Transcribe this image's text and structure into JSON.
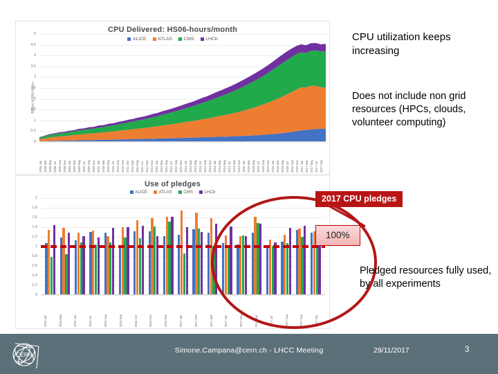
{
  "slide": {
    "page_number": "3"
  },
  "texts": {
    "headline": "CPU utilization keeps increasing",
    "subtext": "Does not include non grid resources (HPCs, clouds, volunteer computing)",
    "bottom": "Pledged resources fully used, by all experiments"
  },
  "callouts": {
    "pledges_label": "2017 CPU pledges",
    "percent_label": "100%"
  },
  "footer": {
    "author": "Simone.Campana@cern.ch - LHCC Meeting",
    "date": "29/11/2017",
    "page": "3",
    "logo": "cern-logo"
  },
  "colors": {
    "alice": "#4472C4",
    "atlas": "#ED7D31",
    "cms": "#22A94C",
    "lhcb": "#7030A0",
    "accent_red": "#b81515",
    "pledge_line": "#c00000",
    "footer_bg": "#5c7079"
  },
  "chart_data": [
    {
      "type": "area",
      "id": "cpu-delivered",
      "title": "CPU Delivered: HS06-hours/month",
      "ylabel": "Billion HS06-hours",
      "xlabel": "",
      "stacked": true,
      "grid": true,
      "legend_position": "top",
      "ylim": [
        0,
        5
      ],
      "yticks": [
        0,
        0.5,
        1,
        1.5,
        2,
        2.5,
        3,
        3.5,
        4,
        4.5,
        5
      ],
      "ytick_labels": [
        "0",
        "0.5",
        "1",
        "1.5",
        "2",
        "2.5",
        "3",
        "3.5",
        "4",
        "4.5",
        "5"
      ],
      "categories": [
        "2008 Jan",
        "2008 Mar",
        "2008 May",
        "2008 Jul",
        "2008 Sep",
        "2008 Nov",
        "2009 Jan",
        "2009 Mar",
        "2009 May",
        "2009 Jul",
        "2009 Sep",
        "2009 Nov",
        "2010 Jan",
        "2010 Mar",
        "2010 May",
        "2010 Jul",
        "2010 Sep",
        "2010 Nov",
        "2011 Jan",
        "2011 Mar",
        "2011 May",
        "2011 Jul",
        "2011 Sep",
        "2011 Nov",
        "2012 Jan",
        "2012 Mar",
        "2012 May",
        "2012 Jul",
        "2012 Sep",
        "2012 Nov",
        "2013 Jan",
        "2013 Mar",
        "2013 May",
        "2013 Jul",
        "2013 Sep",
        "2013 Nov",
        "2014 Jan",
        "2014 Mar",
        "2014 May",
        "2014 Jul",
        "2014 Sep",
        "2014 Nov",
        "2015 Jan",
        "2015 Mar",
        "2015 May",
        "2015 Jul",
        "2015 Sep",
        "2015 Nov",
        "2016 Jan",
        "2016 Mar",
        "2016 May",
        "2016 Jul",
        "2016 Sep",
        "2016 Nov",
        "2017 Jan",
        "2017 Mar",
        "2017 May",
        "2017 Jul",
        "2017 Sep"
      ],
      "series": [
        {
          "name": "ALICE",
          "color": "#4472C4",
          "values": [
            0.03,
            0.04,
            0.05,
            0.05,
            0.06,
            0.06,
            0.07,
            0.07,
            0.08,
            0.08,
            0.09,
            0.09,
            0.1,
            0.1,
            0.11,
            0.11,
            0.12,
            0.12,
            0.13,
            0.13,
            0.14,
            0.14,
            0.15,
            0.15,
            0.16,
            0.17,
            0.17,
            0.18,
            0.18,
            0.19,
            0.2,
            0.2,
            0.21,
            0.22,
            0.22,
            0.23,
            0.24,
            0.24,
            0.25,
            0.26,
            0.27,
            0.28,
            0.29,
            0.3,
            0.31,
            0.33,
            0.34,
            0.36,
            0.38,
            0.4,
            0.43,
            0.46,
            0.5,
            0.53,
            0.56,
            0.58,
            0.6,
            0.61,
            0.62
          ]
        },
        {
          "name": "ATLAS",
          "color": "#ED7D31",
          "values": [
            0.1,
            0.13,
            0.16,
            0.18,
            0.2,
            0.21,
            0.23,
            0.25,
            0.27,
            0.28,
            0.3,
            0.31,
            0.33,
            0.34,
            0.36,
            0.38,
            0.4,
            0.42,
            0.44,
            0.46,
            0.48,
            0.5,
            0.52,
            0.55,
            0.57,
            0.6,
            0.62,
            0.65,
            0.68,
            0.71,
            0.74,
            0.77,
            0.8,
            0.83,
            0.86,
            0.9,
            0.94,
            0.98,
            1.02,
            1.06,
            1.1,
            1.15,
            1.2,
            1.26,
            1.32,
            1.38,
            1.45,
            1.52,
            1.6,
            1.68,
            1.76,
            1.84,
            1.92,
            2.0,
            1.96,
            2.02,
            2.0,
            1.92,
            1.9
          ]
        },
        {
          "name": "CMS",
          "color": "#22A94C",
          "values": [
            0.07,
            0.09,
            0.11,
            0.13,
            0.14,
            0.15,
            0.16,
            0.17,
            0.19,
            0.2,
            0.21,
            0.22,
            0.24,
            0.25,
            0.27,
            0.28,
            0.3,
            0.32,
            0.34,
            0.36,
            0.38,
            0.4,
            0.42,
            0.45,
            0.47,
            0.5,
            0.53,
            0.56,
            0.59,
            0.62,
            0.65,
            0.68,
            0.72,
            0.76,
            0.8,
            0.84,
            0.88,
            0.92,
            0.96,
            1.0,
            1.05,
            1.1,
            1.15,
            1.2,
            1.25,
            1.3,
            1.36,
            1.42,
            1.48,
            1.54,
            1.58,
            1.62,
            1.64,
            1.62,
            1.6,
            1.62,
            1.64,
            1.66,
            1.68
          ]
        },
        {
          "name": "LHCb",
          "color": "#7030A0",
          "values": [
            0.02,
            0.03,
            0.04,
            0.04,
            0.05,
            0.05,
            0.06,
            0.06,
            0.07,
            0.07,
            0.08,
            0.08,
            0.09,
            0.09,
            0.1,
            0.1,
            0.11,
            0.11,
            0.12,
            0.12,
            0.13,
            0.13,
            0.14,
            0.15,
            0.15,
            0.16,
            0.17,
            0.17,
            0.18,
            0.19,
            0.2,
            0.21,
            0.22,
            0.23,
            0.24,
            0.25,
            0.26,
            0.27,
            0.28,
            0.29,
            0.3,
            0.31,
            0.32,
            0.33,
            0.34,
            0.35,
            0.36,
            0.37,
            0.38,
            0.39,
            0.4,
            0.39,
            0.38,
            0.37,
            0.36,
            0.35,
            0.34,
            0.33,
            0.34
          ]
        }
      ]
    },
    {
      "type": "bar",
      "id": "use-of-pledges",
      "title": "Use of pledges",
      "ylabel": "",
      "xlabel": "",
      "grid": true,
      "legend_position": "top",
      "ylim": [
        0,
        2
      ],
      "yticks": [
        0,
        0.2,
        0.4,
        0.6,
        0.8,
        1,
        1.2,
        1.4,
        1.6,
        1.8,
        2
      ],
      "ytick_labels": [
        "0",
        "0.2",
        "0.4",
        "0.6",
        "0.8",
        "1",
        "1.2",
        "1.4",
        "1.6",
        "1.8",
        "2"
      ],
      "reference_line": {
        "value": 1,
        "label": "100%",
        "color": "#c00000",
        "style": "dashed"
      },
      "categories": [
        "2016 Apr",
        "2016 May",
        "2016 Jun",
        "2016 Jul",
        "2016 Aug",
        "2016 Sep",
        "2016 Oct",
        "2016 Nov",
        "2016 Dec",
        "2017 Jan",
        "2017 Feb",
        "2017 Mar",
        "2017 Apr",
        "2017 May",
        "2017 Jun",
        "2017 Jul",
        "2017 Aug",
        "2017 Sep",
        "2017 Oct"
      ],
      "series": [
        {
          "name": "ALICE",
          "color": "#4472C4",
          "values": [
            1.07,
            1.19,
            1.13,
            1.3,
            1.28,
            1.03,
            1.31,
            1.32,
            1.21,
            1.25,
            1.36,
            1.29,
            1.07,
            1.05,
            1.29,
            1.01,
            1.1,
            1.34,
            1.29
          ]
        },
        {
          "name": "ATLAS",
          "color": "#ED7D31",
          "values": [
            1.34,
            1.38,
            1.28,
            1.33,
            1.22,
            1.4,
            1.54,
            1.58,
            1.62,
            1.75,
            1.7,
            1.58,
            1.23,
            1.22,
            1.61,
            1.15,
            1.25,
            1.37,
            1.32
          ]
        },
        {
          "name": "CMS",
          "color": "#22A94C",
          "values": [
            0.79,
            0.85,
            1.08,
            1.05,
            1.09,
            1.19,
            1.17,
            1.41,
            1.51,
            0.86,
            1.37,
            1.02,
            1.01,
            1.23,
            1.48,
            1.02,
            1.07,
            1.2,
            1.22
          ]
        },
        {
          "name": "LHCb",
          "color": "#7030A0",
          "values": [
            1.44,
            1.28,
            1.21,
            1.18,
            1.38,
            1.4,
            1.43,
            1.21,
            1.61,
            1.4,
            1.3,
            1.47,
            1.42,
            1.21,
            1.47,
            1.08,
            1.38,
            1.43,
            1.31
          ]
        }
      ]
    }
  ]
}
